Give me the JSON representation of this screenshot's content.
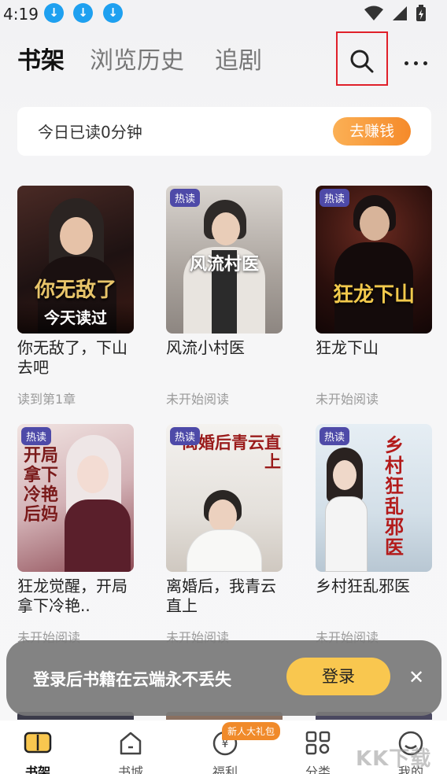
{
  "status_bar": {
    "time": "4:19"
  },
  "header": {
    "tabs": [
      {
        "label": "书架",
        "active": true
      },
      {
        "label": "浏览历史",
        "active": false
      },
      {
        "label": "追剧",
        "active": false
      }
    ],
    "icons": [
      "search-icon",
      "more-icon"
    ]
  },
  "reading_card": {
    "text": "今日已读0分钟",
    "button": "去赚钱"
  },
  "books": [
    {
      "title": "你无敌了，下山去吧",
      "status": "读到第1章",
      "hot": "",
      "cover_text": "你无敌了",
      "cover_sub": "今天读过",
      "cover_color": "#2a1a1a"
    },
    {
      "title": "风流小村医",
      "status": "未开始阅读",
      "hot": "热读",
      "cover_text": "风流村医",
      "cover_sub": "",
      "cover_color": "#b9b3ad"
    },
    {
      "title": "狂龙下山",
      "status": "未开始阅读",
      "hot": "热读",
      "cover_text": "狂龙下山",
      "cover_sub": "",
      "cover_color": "#3a1512"
    },
    {
      "title": "狂龙觉醒，开局拿下冷艳..",
      "status": "未开始阅读",
      "hot": "热读",
      "cover_text": "开局拿下冷艳后妈",
      "cover_sub": "",
      "cover_color": "#d9c2c4"
    },
    {
      "title": "离婚后，我青云直上",
      "status": "未开始阅读",
      "hot": "热读",
      "cover_text": "离婚后青云直上",
      "cover_sub": "",
      "cover_color": "#ecebea"
    },
    {
      "title": "乡村狂乱邪医",
      "status": "未开始阅读",
      "hot": "热读",
      "cover_text": "乡村狂乱邪医",
      "cover_sub": "",
      "cover_color": "#d8e3ec"
    }
  ],
  "toast": {
    "text": "登录后书籍在云端永不丢失",
    "button": "登录"
  },
  "bottom_nav": {
    "items": [
      {
        "label": "书架",
        "icon": "bookshelf-icon",
        "active": true
      },
      {
        "label": "书城",
        "icon": "store-icon",
        "active": false
      },
      {
        "label": "福利",
        "icon": "welfare-icon",
        "active": false
      },
      {
        "label": "分类",
        "icon": "category-icon",
        "active": false
      },
      {
        "label": "我的",
        "icon": "profile-icon",
        "active": false
      }
    ],
    "gift_badge": "新人大礼包"
  },
  "watermark": "KK下载",
  "colors": {
    "accent_orange": "#f58a2a",
    "login_yellow": "#f9c74f",
    "hot_tag": "#4e4aa8",
    "highlight_red": "#e0202a"
  }
}
